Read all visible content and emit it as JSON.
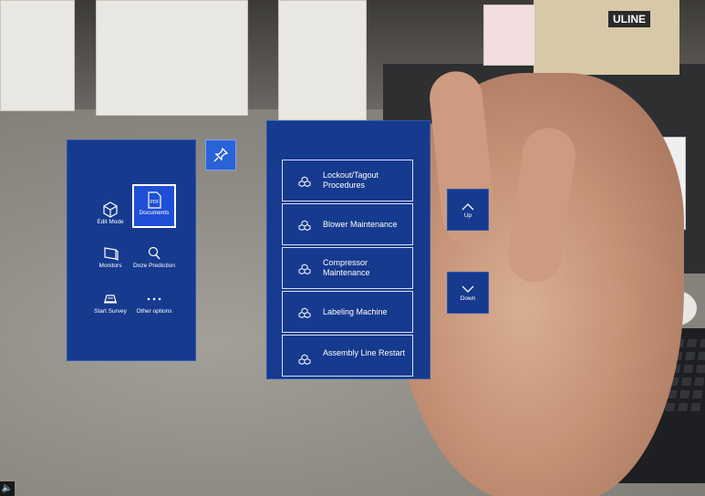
{
  "side_menu": {
    "items": [
      {
        "label": "Edit Mode",
        "icon": "cube-icon"
      },
      {
        "label": "Documents",
        "icon": "pdf-icon",
        "active": true
      },
      {
        "label": "Monitors",
        "icon": "monitor-icon"
      },
      {
        "label": "Doze Prediction",
        "icon": "search-icon"
      },
      {
        "label": "Start Survey",
        "icon": "survey-icon"
      },
      {
        "label": "Other options",
        "icon": "more-icon"
      }
    ],
    "pin_icon": "pin-icon"
  },
  "documents": {
    "items": [
      {
        "label": "Lockout/Tagout Procedures"
      },
      {
        "label": "Blower Maintenance"
      },
      {
        "label": "Compressor Maintenance"
      },
      {
        "label": "Labeling Machine"
      },
      {
        "label": "Assembly Line Restart"
      }
    ],
    "item_icon": "cubes-icon"
  },
  "scroll": {
    "up_label": "Up",
    "down_label": "Down"
  },
  "background": {
    "box_text": "ULINE"
  },
  "colors": {
    "panel": "#153a8e",
    "active_tile": "#1f4fd6",
    "pin_button": "#2a63d8"
  }
}
